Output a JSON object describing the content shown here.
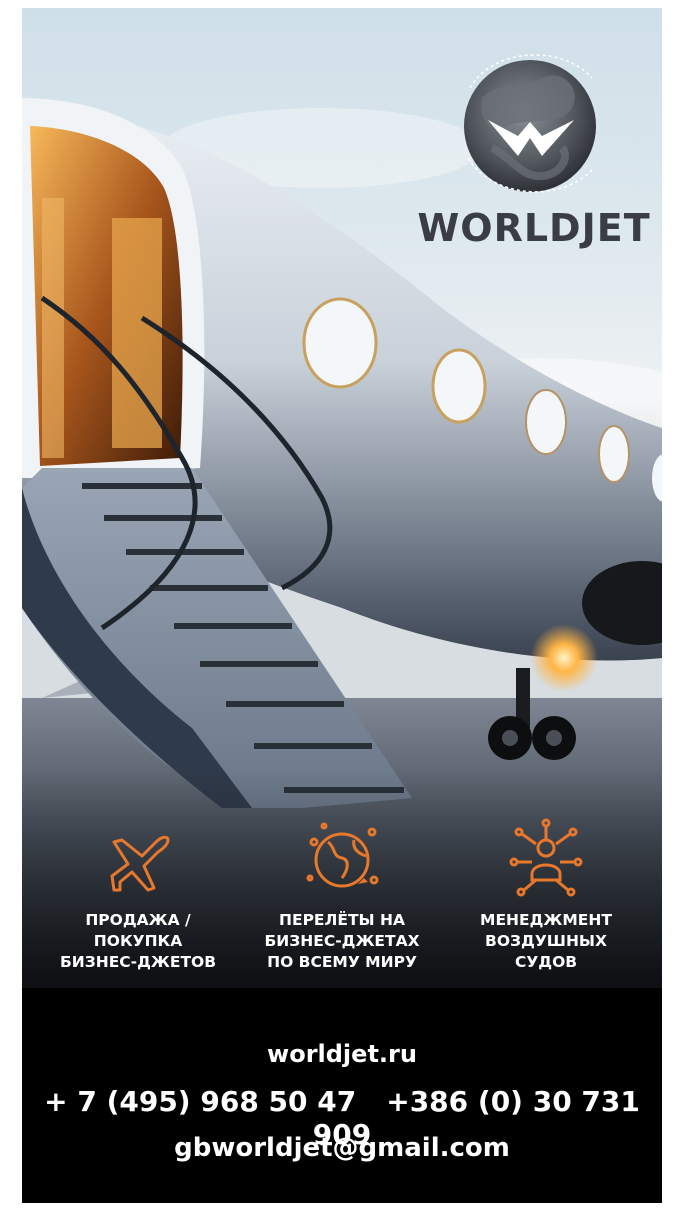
{
  "brand": {
    "name": "WORLDJET",
    "accent": "#e8782b"
  },
  "services": [
    {
      "icon": "airplane-icon",
      "label": "ПРОДАЖА /\nПОКУПКА\nБИЗНЕС-ДЖЕТОВ"
    },
    {
      "icon": "globe-icon",
      "label": "ПЕРЕЛЁТЫ НА\nБИЗНЕС-ДЖЕТАХ\nПО ВСЕМУ МИРУ"
    },
    {
      "icon": "pilot-network-icon",
      "label": "МЕНЕДЖМЕНТ\nВОЗДУШНЫХ\nСУДОВ"
    }
  ],
  "contacts": {
    "website": "worldjet.ru",
    "phone_ru": "+ 7 (495) 968 50 47",
    "phone_si": "+386 (0) 30 731 909",
    "email": "gbworldjet@gmail.com"
  }
}
